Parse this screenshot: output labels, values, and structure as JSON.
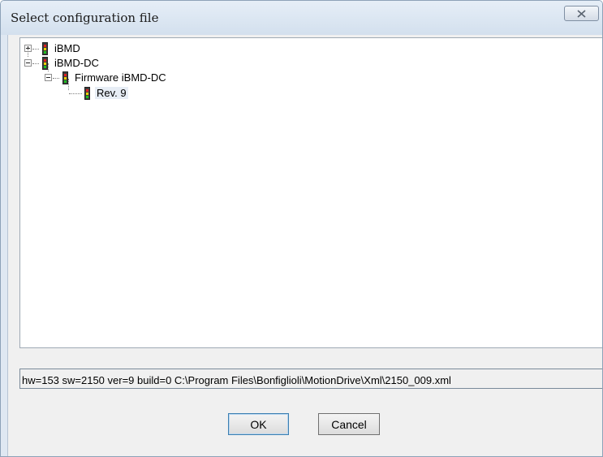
{
  "window": {
    "title": "Select configuration file",
    "close_icon": "close-icon"
  },
  "tree": {
    "items": [
      {
        "label": "iBMD",
        "expanded": false,
        "icon": "device-icon"
      },
      {
        "label": "iBMD-DC",
        "expanded": true,
        "icon": "device-icon",
        "children": [
          {
            "label": "Firmware iBMD-DC",
            "expanded": true,
            "icon": "device-icon",
            "children": [
              {
                "label": "Rev. 9",
                "selected": true,
                "icon": "device-icon"
              }
            ]
          }
        ]
      }
    ]
  },
  "status": {
    "info": "hw=153  sw=2150  ver=9  build=0  C:\\Program Files\\Bonfiglioli\\MotionDrive\\Xml\\2150_009.xml"
  },
  "buttons": {
    "ok_label": "OK",
    "cancel_label": "Cancel"
  },
  "colors": {
    "titlebar": "#dfe8f2",
    "dialog_bg": "#f0f0f0",
    "icon_red": "#e02020",
    "icon_yellow": "#f0d000",
    "icon_green": "#20c020"
  }
}
